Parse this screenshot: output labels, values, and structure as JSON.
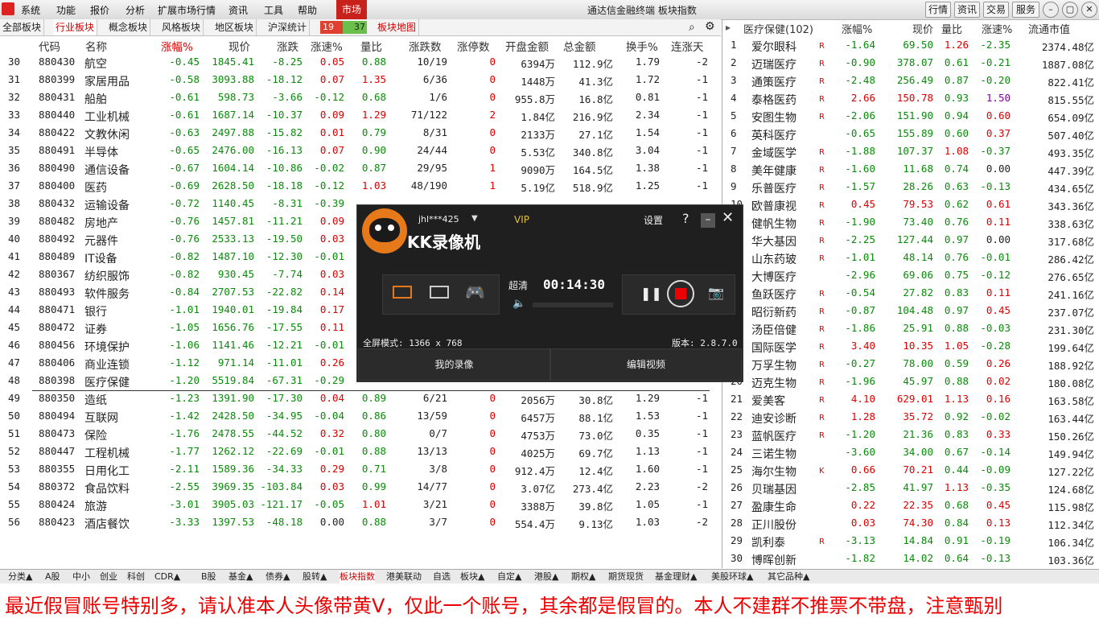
{
  "menubar": {
    "items": [
      "系统",
      "功能",
      "报价",
      "分析",
      "扩展市场行情",
      "资讯",
      "工具",
      "帮助"
    ],
    "market": "市场",
    "title": "通达信金融终端 板块指数",
    "right_buttons": [
      "行情",
      "资讯",
      "交易",
      "服务"
    ]
  },
  "tabs": {
    "items": [
      "全部板块",
      "行业板块",
      "概念板块",
      "风格板块",
      "地区板块",
      "沪深统计"
    ],
    "counter_red": "19",
    "counter_green": "37",
    "map": "板块地图"
  },
  "left_table": {
    "headers": [
      "代码",
      "名称",
      "涨幅%",
      "现价",
      "涨跌",
      "涨速%",
      "量比",
      "涨跌数",
      "涨停数",
      "开盘金额",
      "总金额",
      "换手%",
      "连涨天"
    ],
    "rows": [
      [
        "30",
        "880430",
        "航空",
        "-0.45",
        "1845.41",
        "-8.25",
        "0.05",
        "0.88",
        "10/19",
        "0",
        "6394万",
        "112.9亿",
        "1.79",
        "-2"
      ],
      [
        "31",
        "880399",
        "家居用品",
        "-0.58",
        "3093.88",
        "-18.12",
        "0.07",
        "1.35",
        "6/36",
        "0",
        "1448万",
        "41.3亿",
        "1.72",
        "-1"
      ],
      [
        "32",
        "880431",
        "船舶",
        "-0.61",
        "598.73",
        "-3.66",
        "-0.12",
        "0.68",
        "1/6",
        "0",
        "955.8万",
        "16.8亿",
        "0.81",
        "-1"
      ],
      [
        "33",
        "880440",
        "工业机械",
        "-0.61",
        "1687.14",
        "-10.37",
        "0.09",
        "1.29",
        "71/122",
        "2",
        "1.84亿",
        "216.9亿",
        "2.34",
        "-1"
      ],
      [
        "34",
        "880422",
        "文教休闲",
        "-0.63",
        "2497.88",
        "-15.82",
        "0.01",
        "0.79",
        "8/31",
        "0",
        "2133万",
        "27.1亿",
        "1.54",
        "-1"
      ],
      [
        "35",
        "880491",
        "半导体",
        "-0.65",
        "2476.00",
        "-16.13",
        "0.07",
        "0.90",
        "24/44",
        "0",
        "5.53亿",
        "340.8亿",
        "3.04",
        "-1"
      ],
      [
        "36",
        "880490",
        "通信设备",
        "-0.67",
        "1604.14",
        "-10.86",
        "-0.02",
        "0.87",
        "29/95",
        "1",
        "9090万",
        "164.5亿",
        "1.38",
        "-1"
      ],
      [
        "37",
        "880400",
        "医药",
        "-0.69",
        "2628.50",
        "-18.18",
        "-0.12",
        "1.03",
        "48/190",
        "1",
        "5.19亿",
        "518.9亿",
        "1.25",
        "-1"
      ],
      [
        "38",
        "880432",
        "运输设备",
        "-0.72",
        "1140.45",
        "-8.31",
        "-0.39",
        "",
        "",
        "",
        "",
        "",
        "",
        ""
      ],
      [
        "39",
        "880482",
        "房地产",
        "-0.76",
        "1457.81",
        "-11.21",
        "0.09",
        "",
        "",
        "",
        "",
        "",
        "",
        ""
      ],
      [
        "40",
        "880492",
        "元器件",
        "-0.76",
        "2533.13",
        "-19.50",
        "0.03",
        "",
        "",
        "",
        "",
        "",
        "",
        ""
      ],
      [
        "41",
        "880489",
        "IT设备",
        "-0.82",
        "1487.10",
        "-12.30",
        "-0.01",
        "",
        "",
        "",
        "",
        "",
        "",
        ""
      ],
      [
        "42",
        "880367",
        "纺织服饰",
        "-0.82",
        "930.45",
        "-7.74",
        "0.03",
        "",
        "",
        "",
        "",
        "",
        "",
        ""
      ],
      [
        "43",
        "880493",
        "软件服务",
        "-0.84",
        "2707.53",
        "-22.82",
        "0.14",
        "",
        "",
        "",
        "",
        "",
        "",
        ""
      ],
      [
        "44",
        "880471",
        "银行",
        "-1.01",
        "1940.01",
        "-19.84",
        "0.17",
        "",
        "",
        "",
        "",
        "",
        "",
        ""
      ],
      [
        "45",
        "880472",
        "证券",
        "-1.05",
        "1656.76",
        "-17.55",
        "0.11",
        "",
        "",
        "",
        "",
        "",
        "",
        ""
      ],
      [
        "46",
        "880456",
        "环境保护",
        "-1.06",
        "1141.46",
        "-12.21",
        "-0.01",
        "",
        "",
        "",
        "",
        "",
        "",
        ""
      ],
      [
        "47",
        "880406",
        "商业连锁",
        "-1.12",
        "971.14",
        "-11.01",
        "0.26",
        "",
        "",
        "",
        "",
        "",
        "",
        ""
      ],
      [
        "48",
        "880398",
        "医疗保健",
        "-1.20",
        "5519.84",
        "-67.31",
        "-0.29",
        "",
        "",
        "",
        "",
        "",
        "",
        ""
      ],
      [
        "49",
        "880350",
        "造纸",
        "-1.23",
        "1391.90",
        "-17.30",
        "0.04",
        "0.89",
        "6/21",
        "0",
        "2056万",
        "30.8亿",
        "1.29",
        "-1"
      ],
      [
        "50",
        "880494",
        "互联网",
        "-1.42",
        "2428.50",
        "-34.95",
        "-0.04",
        "0.86",
        "13/59",
        "0",
        "6457万",
        "88.1亿",
        "1.53",
        "-1"
      ],
      [
        "51",
        "880473",
        "保险",
        "-1.76",
        "2478.55",
        "-44.52",
        "0.32",
        "0.80",
        "0/7",
        "0",
        "4753万",
        "73.0亿",
        "0.35",
        "-1"
      ],
      [
        "52",
        "880447",
        "工程机械",
        "-1.77",
        "1262.12",
        "-22.69",
        "-0.01",
        "0.88",
        "13/13",
        "0",
        "4025万",
        "69.7亿",
        "1.13",
        "-1"
      ],
      [
        "53",
        "880355",
        "日用化工",
        "-2.11",
        "1589.36",
        "-34.33",
        "0.29",
        "0.71",
        "3/8",
        "0",
        "912.4万",
        "12.4亿",
        "1.60",
        "-1"
      ],
      [
        "54",
        "880372",
        "食品饮料",
        "-2.55",
        "3969.35",
        "-103.84",
        "0.03",
        "0.99",
        "14/77",
        "0",
        "3.07亿",
        "273.4亿",
        "2.23",
        "-2"
      ],
      [
        "55",
        "880424",
        "旅游",
        "-3.01",
        "3905.03",
        "-121.17",
        "-0.05",
        "1.01",
        "3/21",
        "0",
        "3388万",
        "39.8亿",
        "1.05",
        "-1"
      ],
      [
        "56",
        "880423",
        "酒店餐饮",
        "-3.33",
        "1397.53",
        "-48.18",
        "0.00",
        "0.88",
        "3/7",
        "0",
        "554.4万",
        "9.13亿",
        "1.03",
        "-2"
      ]
    ]
  },
  "right_table": {
    "title": "医疗保健(102)",
    "headers": [
      "涨幅%",
      "现价",
      "量比",
      "涨速%",
      "流通市值"
    ],
    "rows": [
      [
        "1",
        "爱尔眼科",
        "R",
        "-1.64",
        "69.50",
        "1.26",
        "-2.35",
        "2374.48亿"
      ],
      [
        "2",
        "迈瑞医疗",
        "R",
        "-0.90",
        "378.07",
        "0.61",
        "-0.21",
        "1887.08亿"
      ],
      [
        "3",
        "通策医疗",
        "R",
        "-2.48",
        "256.49",
        "0.87",
        "-0.20",
        "822.41亿"
      ],
      [
        "4",
        "泰格医药",
        "R",
        "2.66",
        "150.78",
        "0.93",
        "1.50",
        "815.55亿"
      ],
      [
        "5",
        "安图生物",
        "R",
        "-2.06",
        "151.90",
        "0.94",
        "0.60",
        "654.09亿"
      ],
      [
        "6",
        "英科医疗",
        "",
        "-0.65",
        "155.89",
        "0.60",
        "0.37",
        "507.40亿"
      ],
      [
        "7",
        "金域医学",
        "R",
        "-1.88",
        "107.37",
        "1.08",
        "-0.37",
        "493.35亿"
      ],
      [
        "8",
        "美年健康",
        "R",
        "-1.60",
        "11.68",
        "0.74",
        "0.00",
        "447.39亿"
      ],
      [
        "9",
        "乐普医疗",
        "R",
        "-1.57",
        "28.26",
        "0.63",
        "-0.13",
        "434.65亿"
      ],
      [
        "10",
        "欧普康视",
        "R",
        "0.45",
        "79.53",
        "0.62",
        "0.61",
        "343.36亿"
      ],
      [
        "11",
        "健帆生物",
        "R",
        "-1.90",
        "73.40",
        "0.76",
        "0.11",
        "338.63亿"
      ],
      [
        "12",
        "华大基因",
        "R",
        "-2.25",
        "127.44",
        "0.97",
        "0.00",
        "317.68亿"
      ],
      [
        "13",
        "山东药玻",
        "R",
        "-1.01",
        "48.14",
        "0.76",
        "-0.01",
        "286.42亿"
      ],
      [
        "14",
        "大博医疗",
        "",
        "-2.96",
        "69.06",
        "0.75",
        "-0.12",
        "276.65亿"
      ],
      [
        "15",
        "鱼跃医疗",
        "R",
        "-0.54",
        "27.82",
        "0.83",
        "0.11",
        "241.16亿"
      ],
      [
        "16",
        "昭衍新药",
        "R",
        "-0.87",
        "104.48",
        "0.97",
        "0.45",
        "237.07亿"
      ],
      [
        "17",
        "汤臣倍健",
        "R",
        "-1.86",
        "25.91",
        "0.88",
        "-0.03",
        "231.30亿"
      ],
      [
        "18",
        "国际医学",
        "R",
        "3.40",
        "10.35",
        "1.05",
        "-0.28",
        "199.64亿"
      ],
      [
        "19",
        "万孚生物",
        "R",
        "-0.27",
        "78.00",
        "0.59",
        "0.26",
        "188.92亿"
      ],
      [
        "20",
        "迈克生物",
        "R",
        "-1.96",
        "45.97",
        "0.88",
        "0.02",
        "180.08亿"
      ],
      [
        "21",
        "爱美客",
        "R",
        "4.10",
        "629.01",
        "1.13",
        "0.16",
        "163.58亿"
      ],
      [
        "22",
        "迪安诊断",
        "R",
        "1.28",
        "35.72",
        "0.92",
        "-0.02",
        "163.44亿"
      ],
      [
        "23",
        "蓝帆医疗",
        "R",
        "-1.20",
        "21.36",
        "0.83",
        "0.33",
        "150.26亿"
      ],
      [
        "24",
        "三诺生物",
        "",
        "-3.60",
        "34.00",
        "0.67",
        "-0.14",
        "149.94亿"
      ],
      [
        "25",
        "海尔生物",
        "K",
        "0.66",
        "70.21",
        "0.44",
        "-0.09",
        "127.22亿"
      ],
      [
        "26",
        "贝瑞基因",
        "",
        "-2.85",
        "41.97",
        "1.13",
        "-0.35",
        "124.68亿"
      ],
      [
        "27",
        "盈康生命",
        "",
        "0.22",
        "22.35",
        "0.68",
        "0.45",
        "115.98亿"
      ],
      [
        "28",
        "正川股份",
        "",
        "0.03",
        "74.30",
        "0.84",
        "0.13",
        "112.34亿"
      ],
      [
        "29",
        "凯利泰",
        "R",
        "-3.13",
        "14.84",
        "0.91",
        "-0.19",
        "106.34亿"
      ],
      [
        "30",
        "博晖创新",
        "",
        "-1.82",
        "14.02",
        "0.64",
        "-0.13",
        "103.36亿"
      ]
    ]
  },
  "bottom_tabs": [
    "分类▲",
    "A股",
    "中小",
    "创业",
    "科创",
    "CDR▲",
    "B股",
    "基金▲",
    "债券▲",
    "股转▲",
    "板块指数",
    "港美联动",
    "自选",
    "板块▲",
    "自定▲",
    "港股▲",
    "期权▲",
    "期货现货",
    "基金理财▲",
    "美股环球▲",
    "其它品种▲"
  ],
  "banner": "最近假冒账号特别多，请认准本人头像带黄V，仅此一个账号，其余都是假冒的。本人不建群不推票不带盘，注意甄别",
  "recorder": {
    "user": "jhl***425",
    "vip": "VIP",
    "title": "KK录像机",
    "settings": "设置",
    "help": "?",
    "quality": "超清",
    "timer": "00:14:30",
    "mode": "全屏模式: 1366 x 768",
    "version": "版本: 2.8.7.0",
    "btn_my": "我的录像",
    "btn_edit": "编辑视频"
  },
  "colors": {
    "up": "#d00000",
    "down": "#0a8a0a",
    "accent": "#c8201a"
  }
}
